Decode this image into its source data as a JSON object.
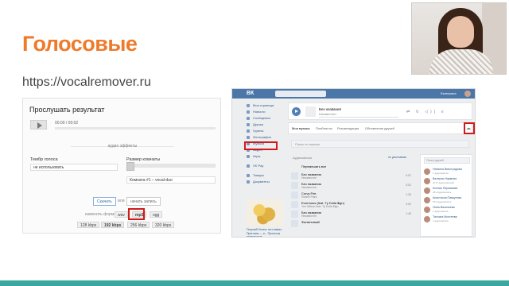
{
  "slide": {
    "title": "Голосовые",
    "url": "https://vocalremover.ru",
    "accent_color": "#ee7a2b",
    "bar_color": "#3aa7a0"
  },
  "vocalremover": {
    "heading": "Прослушать результат",
    "time": "00:00 / 00:02",
    "effects_label": "аудио эффекты",
    "voice_label": "Тембр голоса",
    "voice_value": "не использовать",
    "room_label": "Размер комнаты",
    "room_value": "Комната #1 – vocal-duo",
    "download_button": "Скачать",
    "or_text": "или",
    "record_button": "начать запись",
    "format_label": "изменить формат",
    "formats": [
      "wav",
      "mp3",
      "ogg"
    ],
    "bitrates": [
      "128 kbps",
      "192 kbps",
      "256 kbps",
      "320 kbps"
    ]
  },
  "vk": {
    "logo": "ВК",
    "user_name": "Екатерина",
    "sidebar": [
      "Моя страница",
      "Новости",
      "Сообщения",
      "Друзья",
      "Группы",
      "Фотографии",
      "Музыка",
      "Видео",
      "Игры",
      "VK Pay",
      "Товары",
      "Документы"
    ],
    "ad_text": "Покупай Гелиос на ставках. Пригласи — и... Прогнозы интересные",
    "player": {
      "title": "Без названия",
      "artist": "Неизвестен"
    },
    "tabs": [
      "Моя музыка",
      "Плейлисты",
      "Рекомендации",
      "Обновления друзей"
    ],
    "search_placeholder": "Поиск по музыке",
    "audio_header": "Аудиозаписи",
    "sort_label": "по умолчанию",
    "shuffle": "Перемешать все",
    "tracks": [
      {
        "title": "Без названия",
        "artist": "Неизвестен",
        "dur": "0:57"
      },
      {
        "title": "Без названия",
        "artist": "Неизвестен",
        "dur": "0:02"
      },
      {
        "title": "Curvy Fire",
        "artist": "Robert Plant",
        "dur": "1:28"
      },
      {
        "title": "Enormous (feat. Ty Dolla $ign)",
        "artist": "Yuri Wilson feat. Ty Dolla $ign",
        "dur": "4:00"
      },
      {
        "title": "Без названия",
        "artist": "Неизвестен",
        "dur": "1:49"
      },
      {
        "title": "Фалкетовый",
        "artist": "",
        "dur": ""
      }
    ],
    "friends_search": "Поиск друзей",
    "friends": [
      {
        "name": "Наталья Виноградова",
        "count": "1 аудиозапись"
      },
      {
        "name": "Валерия Наумова",
        "count": "2717 аудиозаписей"
      },
      {
        "name": "Ксения Пермякова",
        "count": "181 аудиозапись"
      },
      {
        "name": "Анастасия Пивкунова",
        "count": "674 аудиозаписи"
      },
      {
        "name": "Нина Васильева",
        "count": "1 аудиозапись"
      },
      {
        "name": "Татьяна Мохтеева",
        "count": "1 аудиозапись"
      }
    ]
  }
}
